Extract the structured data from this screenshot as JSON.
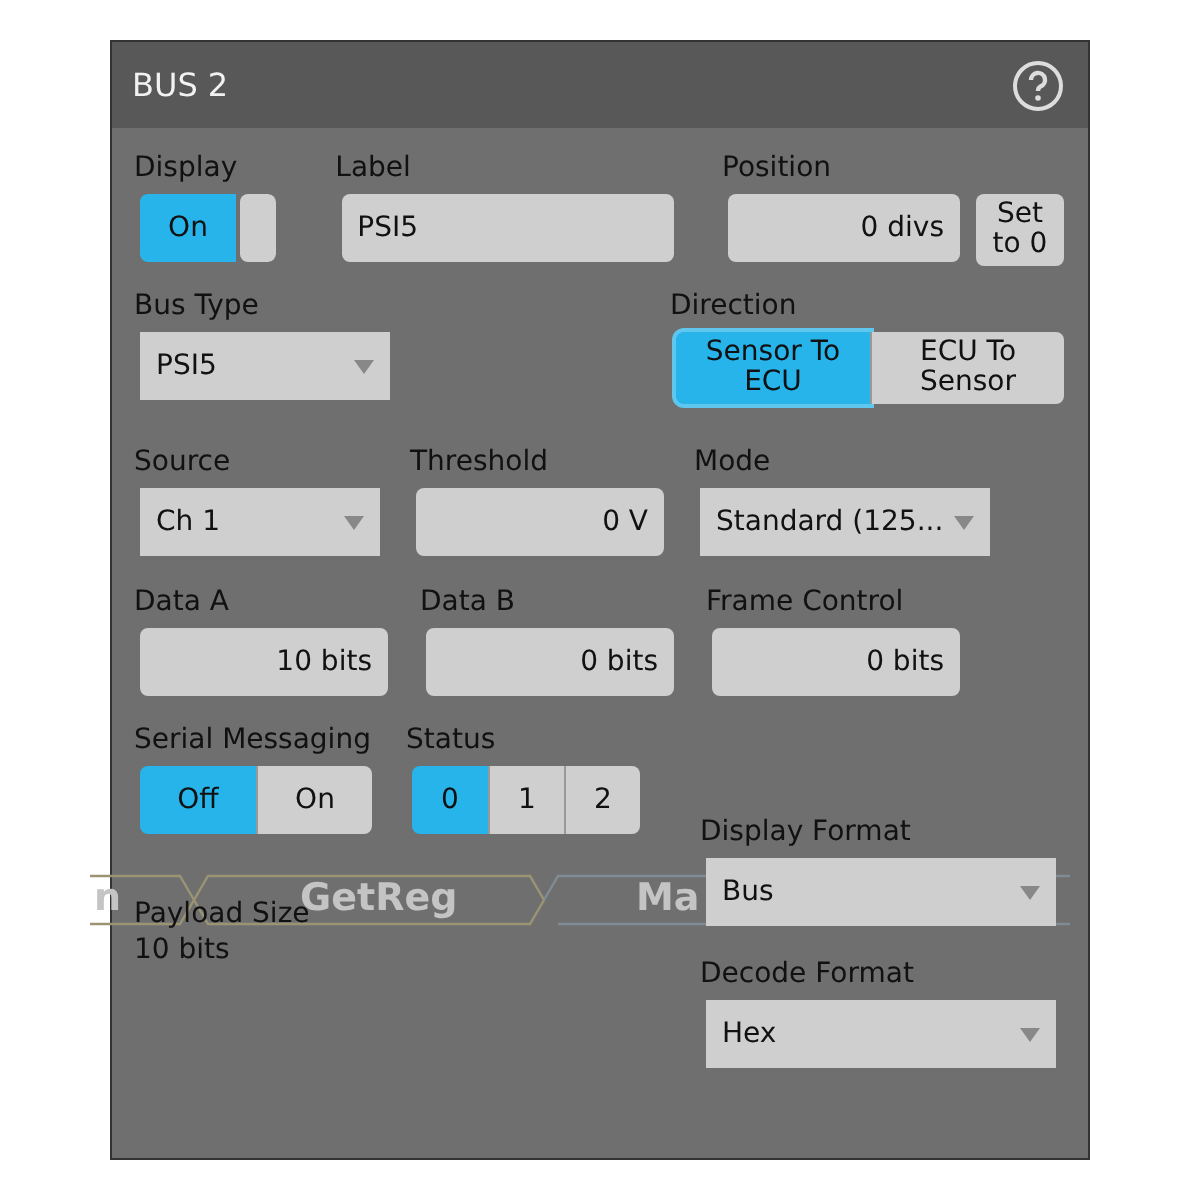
{
  "window": {
    "title": "BUS 2"
  },
  "display": {
    "label": "Display",
    "value": "On",
    "on": true
  },
  "label_field": {
    "label": "Label",
    "value": "PSI5"
  },
  "position": {
    "label": "Position",
    "value": "0 divs",
    "button": "Set\nto 0"
  },
  "bus_type": {
    "label": "Bus Type",
    "value": "PSI5"
  },
  "direction": {
    "label": "Direction",
    "options": [
      {
        "label": "Sensor To\nECU",
        "selected": true
      },
      {
        "label": "ECU To\nSensor",
        "selected": false
      }
    ]
  },
  "source": {
    "label": "Source",
    "value": "Ch 1"
  },
  "threshold": {
    "label": "Threshold",
    "value": "0 V"
  },
  "mode": {
    "label": "Mode",
    "value": "Standard (125..."
  },
  "data_a": {
    "label": "Data A",
    "value": "10 bits"
  },
  "data_b": {
    "label": "Data B",
    "value": "0 bits"
  },
  "frame_control": {
    "label": "Frame Control",
    "value": "0 bits"
  },
  "serial_messaging": {
    "label": "Serial Messaging",
    "options": [
      {
        "label": "Off",
        "selected": true
      },
      {
        "label": "On",
        "selected": false
      }
    ]
  },
  "status": {
    "label": "Status",
    "options": [
      {
        "label": "0",
        "selected": true
      },
      {
        "label": "1",
        "selected": false
      },
      {
        "label": "2",
        "selected": false
      }
    ]
  },
  "payload_size": {
    "label": "Payload Size",
    "value": "10 bits"
  },
  "display_format": {
    "label": "Display Format",
    "value": "Bus"
  },
  "decode_format": {
    "label": "Decode Format",
    "value": "Hex"
  },
  "background_decode": [
    "n",
    "GetReg",
    "Ma"
  ]
}
